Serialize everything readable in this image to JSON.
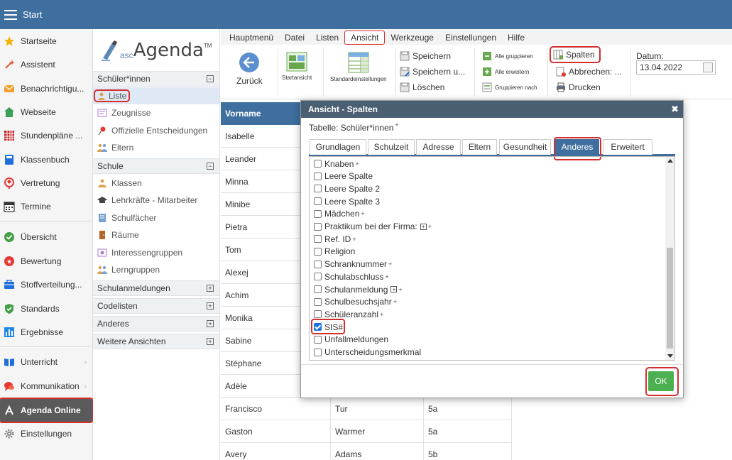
{
  "topbar": {
    "title": "Start"
  },
  "leftnav": [
    {
      "label": "Startseite",
      "icon": "star-icon",
      "color": "#f5b400"
    },
    {
      "label": "Assistent",
      "icon": "wand-icon",
      "color": "#e25a3a"
    },
    {
      "label": "Benachrichtigu...",
      "icon": "envelope-icon",
      "color": "#f0a030"
    },
    {
      "label": "Webseite",
      "icon": "home-icon",
      "color": "#3aa055"
    },
    {
      "label": "Stundenpläne ...",
      "icon": "grid-icon",
      "color": "#c62828"
    },
    {
      "label": "Klassenbuch",
      "icon": "book-icon",
      "color": "#1e6fd9"
    },
    {
      "label": "Vertretung",
      "icon": "person-icon",
      "color": "#e53935"
    },
    {
      "label": "Termine",
      "icon": "calendar-icon",
      "color": "#333333"
    },
    {
      "label": "Übersicht",
      "icon": "check-circle-icon",
      "color": "#43a047"
    },
    {
      "label": "Bewertung",
      "icon": "rating-icon",
      "color": "#e53935"
    },
    {
      "label": "Stoffverteilung...",
      "icon": "briefcase-icon",
      "color": "#1e6fd9"
    },
    {
      "label": "Standards",
      "icon": "shield-icon",
      "color": "#43a047"
    },
    {
      "label": "Ergebnisse",
      "icon": "bar-chart-icon",
      "color": "#1e88e5"
    },
    {
      "label": "Unterricht",
      "icon": "open-book-icon",
      "color": "#1e6fd9"
    },
    {
      "label": "Kommunikation",
      "icon": "chat-icon",
      "color": "#e53935"
    },
    {
      "label": "Agenda Online",
      "icon": "agenda-logo-icon",
      "color": "#ffffff"
    },
    {
      "label": "Einstellungen",
      "icon": "gear-icon",
      "color": "#888888"
    }
  ],
  "sidebar2": {
    "logo_prefix": "asc",
    "logo_name": "Agenda",
    "logo_tm": "TM",
    "sections": {
      "schueler": {
        "label": "Schüler*innen",
        "toggle": "−"
      },
      "schule": {
        "label": "Schule",
        "toggle": "−"
      },
      "schulanmeldungen": {
        "label": "Schulanmeldungen",
        "toggle": "+"
      },
      "codelisten": {
        "label": "Codelisten",
        "toggle": "+"
      },
      "anderes": {
        "label": "Anderes",
        "toggle": "+"
      },
      "weitere": {
        "label": "Weitere Ansichten",
        "toggle": "+"
      }
    },
    "schueler_items": [
      "Liste",
      "Zeugnisse",
      "Offizielle Entscheidungen",
      "Eltern"
    ],
    "schule_items": [
      "Klassen",
      "Lehrkräfte - Mitarbeiter",
      "Schulfächer",
      "Räume",
      "Interessengruppen",
      "Lerngruppen"
    ]
  },
  "menubar": [
    "Hauptmenü",
    "Datei",
    "Listen",
    "Ansicht",
    "Werkzeuge",
    "Einstellungen",
    "Hilfe"
  ],
  "ribbon": {
    "back": "Zurück",
    "startansicht": "Startansicht",
    "standardeinstellungen": "Standardeinstellungen",
    "speichern": "Speichern",
    "speichern_unter": "Speichern u...",
    "loeschen": "Löschen",
    "alle_gruppieren": "Alle gruppieren",
    "alle_erweitern": "Alle erweitern",
    "gruppieren_nach": "Gruppieren nach",
    "spalten": "Spalten",
    "abbrechen": "Abbrechen: ...",
    "drucken": "Drucken",
    "datum_label": "Datum:",
    "datum_value": "13.04.2022"
  },
  "table": {
    "header_vorname": "Vorname",
    "rows": [
      {
        "vorname": "Isabelle",
        "nachname": "",
        "klasse": ""
      },
      {
        "vorname": "Leander",
        "nachname": "",
        "klasse": ""
      },
      {
        "vorname": "Minna",
        "nachname": "",
        "klasse": ""
      },
      {
        "vorname": "Minibe",
        "nachname": "",
        "klasse": ""
      },
      {
        "vorname": "Pietra",
        "nachname": "",
        "klasse": ""
      },
      {
        "vorname": "Tom",
        "nachname": "",
        "klasse": ""
      },
      {
        "vorname": "Alexej",
        "nachname": "",
        "klasse": ""
      },
      {
        "vorname": "Achim",
        "nachname": "",
        "klasse": ""
      },
      {
        "vorname": "Monika",
        "nachname": "",
        "klasse": ""
      },
      {
        "vorname": "Sabine",
        "nachname": "",
        "klasse": ""
      },
      {
        "vorname": "Stéphane",
        "nachname": "",
        "klasse": ""
      },
      {
        "vorname": "Adèle",
        "nachname": "",
        "klasse": ""
      },
      {
        "vorname": "Francisco",
        "nachname": "Tur",
        "klasse": "5a"
      },
      {
        "vorname": "Gaston",
        "nachname": "Warmer",
        "klasse": "5a"
      },
      {
        "vorname": "Avery",
        "nachname": "Adams",
        "klasse": "5b"
      }
    ]
  },
  "dialog": {
    "title": "Ansicht - Spalten",
    "close": "✖",
    "subtitle": "Tabelle: Schüler*innen",
    "subtitle_mark": "+",
    "tabs": [
      "Grundlagen",
      "Schulzeit",
      "Adresse",
      "Eltern",
      "Gesundheit",
      "Anderes",
      "Erweitert"
    ],
    "active_tab": "Anderes",
    "items": [
      {
        "label": "Knaben",
        "checked": false,
        "plus": true,
        "expand": false
      },
      {
        "label": "Leere Spalte",
        "checked": false,
        "plus": false,
        "expand": false
      },
      {
        "label": "Leere Spalte 2",
        "checked": false,
        "plus": false,
        "expand": false
      },
      {
        "label": "Leere Spalte 3",
        "checked": false,
        "plus": false,
        "expand": false
      },
      {
        "label": "Mädchen",
        "checked": false,
        "plus": true,
        "expand": false
      },
      {
        "label": "Praktikum bei der Firma:",
        "checked": false,
        "plus": true,
        "expand": true
      },
      {
        "label": "Ref. ID",
        "checked": false,
        "plus": true,
        "expand": false
      },
      {
        "label": "Religion",
        "checked": false,
        "plus": false,
        "expand": false
      },
      {
        "label": "Schranknummer",
        "checked": false,
        "plus": true,
        "expand": false
      },
      {
        "label": "Schulabschluss",
        "checked": false,
        "plus": true,
        "expand": false
      },
      {
        "label": "Schulanmeldung",
        "checked": false,
        "plus": true,
        "expand": true
      },
      {
        "label": "Schulbesuchsjahr",
        "checked": false,
        "plus": true,
        "expand": false
      },
      {
        "label": "Schüleranzahl",
        "checked": false,
        "plus": true,
        "expand": false
      },
      {
        "label": "SIS#",
        "checked": true,
        "plus": false,
        "expand": false
      },
      {
        "label": "Unfallmeldungen",
        "checked": false,
        "plus": false,
        "expand": false
      },
      {
        "label": "Unterscheidungsmerkmal",
        "checked": false,
        "plus": false,
        "expand": false
      }
    ],
    "ok": "OK"
  },
  "colors": {
    "primary": "#3f6f9f",
    "highlight": "#d32f2f",
    "ok": "#4caf50",
    "dialog_title": "#4b5f73"
  }
}
